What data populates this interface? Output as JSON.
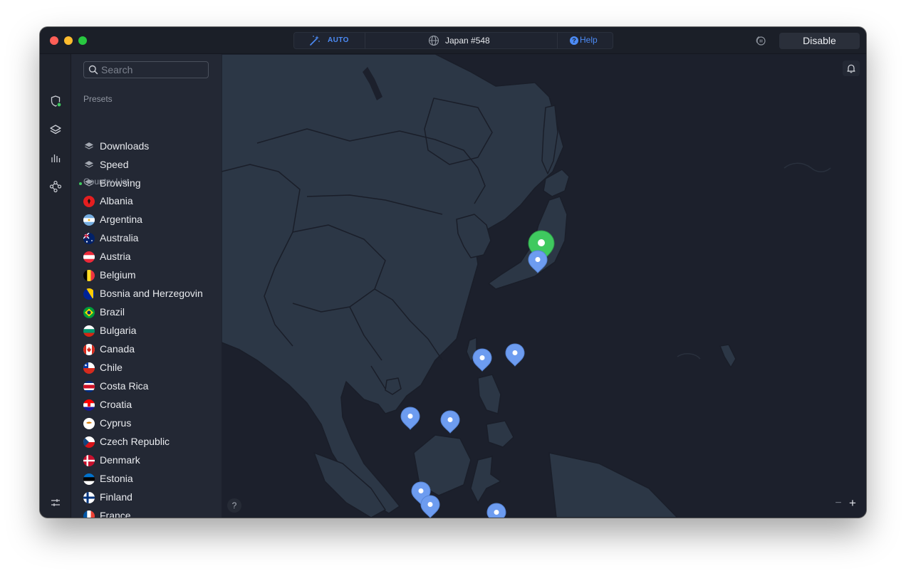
{
  "titlebar": {
    "auto_label": "AUTO",
    "server_label": "Japan #548",
    "help_label": "Help",
    "disable_label": "Disable"
  },
  "sidebar": {
    "search_placeholder": "Search",
    "presets_title": "Presets",
    "presets": [
      {
        "label": "Downloads",
        "active": false
      },
      {
        "label": "Speed",
        "active": false
      },
      {
        "label": "Browsing",
        "active": true
      }
    ],
    "countries_title": "Country List",
    "countries": [
      {
        "label": "Albania"
      },
      {
        "label": "Argentina"
      },
      {
        "label": "Australia"
      },
      {
        "label": "Austria"
      },
      {
        "label": "Belgium"
      },
      {
        "label": "Bosnia and Herzegovin"
      },
      {
        "label": "Brazil"
      },
      {
        "label": "Bulgaria"
      },
      {
        "label": "Canada"
      },
      {
        "label": "Chile"
      },
      {
        "label": "Costa Rica"
      },
      {
        "label": "Croatia"
      },
      {
        "label": "Cyprus"
      },
      {
        "label": "Czech Republic"
      },
      {
        "label": "Denmark"
      },
      {
        "label": "Estonia"
      },
      {
        "label": "Finland"
      },
      {
        "label": "France"
      }
    ]
  },
  "map": {
    "help_label": "?",
    "zoom_out_label": "−",
    "zoom_in_label": "+"
  },
  "colors": {
    "accent_blue": "#4c8bf5",
    "connected_green": "#3fc95f",
    "pin_blue": "#6d9cf0",
    "map_land": "#2c3746",
    "map_water": "#1c202c"
  }
}
